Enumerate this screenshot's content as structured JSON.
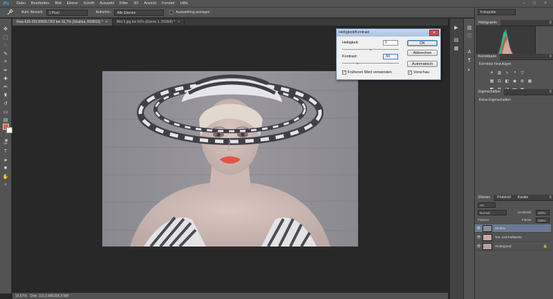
{
  "app": {
    "logo": "Ps",
    "menu": [
      "Datei",
      "Bearbeiten",
      "Bild",
      "Ebene",
      "Schrift",
      "Auswahl",
      "Filter",
      "3D",
      "Ansicht",
      "Fenster",
      "Hilfe"
    ],
    "window_controls": {
      "minimize": "–",
      "maximize": "□",
      "close": "×"
    }
  },
  "options_bar": {
    "tool_icon": "eyedropper-icon",
    "sample_size_label": "Aufn.-Bereich:",
    "sample_size_value": "1 Pixel",
    "sample_label": "Aufnehm.:",
    "sample_value": "Alle Ebenen",
    "show_ring_label": "Auswahlring anzeigen",
    "workspace": "Fotografie"
  },
  "tabs": [
    {
      "label": "Raw-626-20130505.CR2 bei 16,7% (Struktur, RGB/16) *",
      "close": "×",
      "active": true
    },
    {
      "label": "Bild 5.jpg bei 50% (Ebene 1, RGB/8) *",
      "close": "×",
      "active": false
    }
  ],
  "status": {
    "zoom": "16,67%",
    "doc": "Dok: 110,3 MB/395,8 MB"
  },
  "dialog": {
    "title": "Helligkeit/Kontrast",
    "close": "×",
    "brightness_label": "Helligkeit:",
    "brightness_value": "0",
    "contrast_label": "Kontrast:",
    "contrast_value": "-50",
    "ok": "OK",
    "cancel": "Abbrechen",
    "auto": "Automatisch",
    "legacy_label": "Früheren Wert verwenden",
    "legacy_checked": true,
    "preview_label": "Vorschau",
    "preview_checked": true
  },
  "panels": {
    "histogram_tab": "Histogramm",
    "corrections_tab": "Korrekturen",
    "corrections_add": "Korrektur hinzufügen",
    "properties_tab": "Eigenschaften",
    "properties_empty": "Keine Eigenschaften",
    "layers_tabs": [
      "Ebenen",
      "Protokoll",
      "Kanäle"
    ],
    "kind_filter": "Art",
    "blend_mode": "Normal",
    "opacity_label": "Deckkraft:",
    "opacity_value": "100%",
    "lock_label": "Fixieren:",
    "fill_label": "Fläche:",
    "fill_value": "100%",
    "layers": [
      {
        "name": "Struktur",
        "selected": true,
        "locked": false
      },
      {
        "name": "Ton- und Farbwerte",
        "selected": false,
        "locked": false
      },
      {
        "name": "Hintergrund",
        "selected": false,
        "locked": true
      }
    ]
  },
  "colors": {
    "foreground": "#d8673b",
    "background": "#ffffff",
    "accent": "#31a8ff"
  }
}
